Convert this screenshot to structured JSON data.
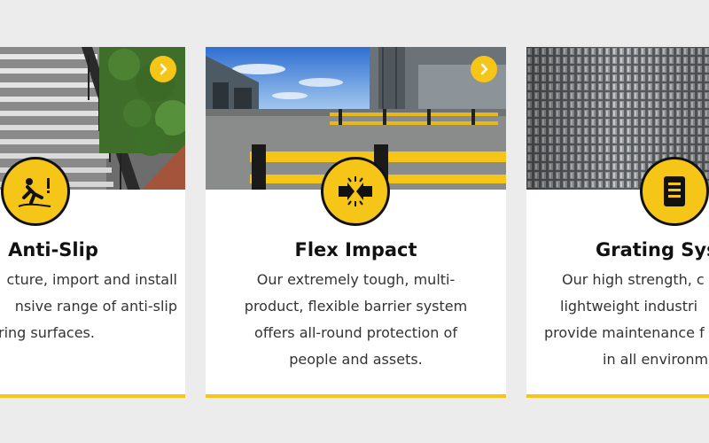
{
  "cards": [
    {
      "title": "Anti-Slip",
      "description_lines": [
        "cture, import and install",
        "nsive range of anti-slip",
        "ring surfaces."
      ],
      "icon": "slip-hazard-icon",
      "link_icon": "chevron-right-icon"
    },
    {
      "title": "Flex Impact",
      "description_lines": [
        "Our extremely tough, multi-",
        "product, flexible barrier system",
        "offers all-round protection of",
        "people and assets."
      ],
      "icon": "impact-arrows-icon",
      "link_icon": "chevron-right-icon"
    },
    {
      "title": "Grating Syst",
      "description_lines": [
        "Our high strength, c",
        "lightweight industri",
        "provide maintenance f",
        "in all environm"
      ],
      "icon": "document-icon"
    }
  ],
  "colors": {
    "accent": "#f5c518",
    "background": "#ececec",
    "card": "#ffffff"
  }
}
